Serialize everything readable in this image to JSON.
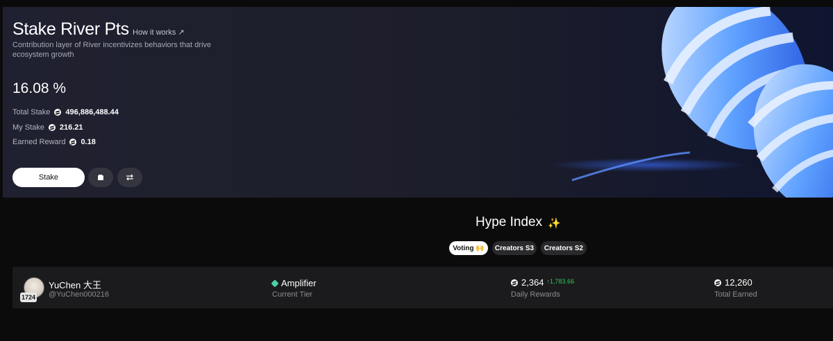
{
  "hero": {
    "title": "Stake River Pts",
    "how_link": "How it works ↗",
    "description": "Contribution layer of River incentivizes behaviors that drive ecosystem growth",
    "apr": "16.08 %",
    "stats": [
      {
        "label": "Total Stake",
        "value": "496,886,488.44"
      },
      {
        "label": "My Stake",
        "value": "216.21"
      },
      {
        "label": "Earned Reward",
        "value": "0.18"
      }
    ],
    "stake_label": "Stake",
    "wallet_icon": "wallet-icon",
    "swap_icon": "swap-icon"
  },
  "hype": {
    "title": "Hype Index",
    "sparkle": "✨",
    "tabs": [
      {
        "label": "Voting 🙌",
        "active": true
      },
      {
        "label": "Creators S3",
        "active": false
      },
      {
        "label": "Creators S2",
        "active": false
      }
    ]
  },
  "user": {
    "name": "YuChen 大王",
    "handle": "@YuChen000216",
    "rank": "1724",
    "tier": "Amplifier",
    "tier_label": "Current Tier",
    "daily_rewards": "2,364",
    "daily_delta": "↑1,783.66",
    "daily_label": "Daily Rewards",
    "total_earned": "12,260",
    "total_label": "Total Earned"
  },
  "colors": {
    "accent_green": "#34c759",
    "sparkle_purple": "#a57bff",
    "tier_teal": "#4fd1a5"
  }
}
